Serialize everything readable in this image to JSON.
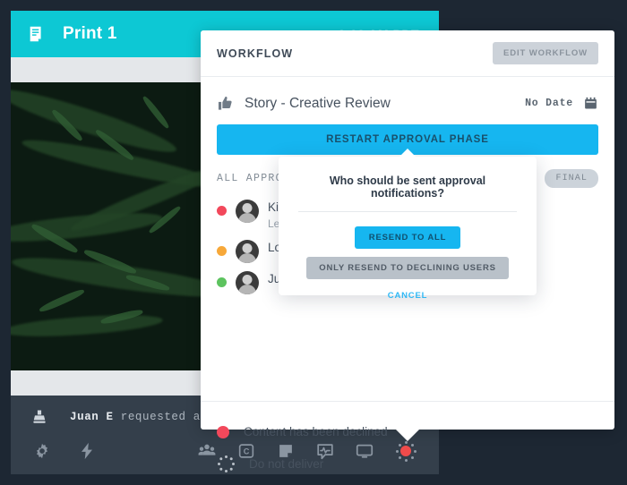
{
  "content_card": {
    "icon": "story-card-icon",
    "title": "Print 1",
    "time": "9:00 AM PDT",
    "activity": {
      "icon": "approval-stamp-icon",
      "actor": "Juan E",
      "text": "requested approv"
    },
    "toolbar": {
      "left": [
        {
          "name": "settings-gear-icon",
          "label": "Settings"
        },
        {
          "name": "automation-bolt-icon",
          "label": "Automation"
        }
      ],
      "right": [
        {
          "name": "audience-people-icon",
          "label": "Audience"
        },
        {
          "name": "campaign-c-icon",
          "label": "Campaign"
        },
        {
          "name": "note-icon",
          "label": "Notes"
        },
        {
          "name": "analytics-pulse-icon",
          "label": "Analytics"
        },
        {
          "name": "preview-monitor-icon",
          "label": "Preview"
        },
        {
          "name": "workflow-status-icon",
          "label": "Workflow",
          "active": true
        }
      ]
    }
  },
  "panel": {
    "header": {
      "title": "WORKFLOW",
      "edit_button": "EDIT WORKFLOW"
    },
    "story": {
      "icon": "thumbs-up-icon",
      "name": "Story - Creative Review",
      "date_label": "No Date",
      "calendar_icon": "calendar-icon"
    },
    "restart_button": "RESTART APPROVAL PHASE",
    "approvers_section": {
      "label": "ALL APPROVERS",
      "badge": "FINAL"
    },
    "approvers": [
      {
        "status_color": "#f2485b",
        "name": "Kimberly R",
        "sub": "Lead Designer"
      },
      {
        "status_color": "#f7a839",
        "name": "Lorena M",
        "sub": ""
      },
      {
        "status_color": "#5dc35f",
        "name": "Juan E",
        "sub": ""
      }
    ],
    "legend": [
      {
        "icon": "declined-dot-icon",
        "text": "Content has been declined"
      },
      {
        "icon": "do-not-deliver-icon",
        "text": "Do not deliver"
      }
    ]
  },
  "modal": {
    "title": "Who should be sent approval notifications?",
    "primary_button": "RESEND TO ALL",
    "secondary_button": "ONLY RESEND TO DECLINING USERS",
    "cancel_button": "CANCEL"
  },
  "colors": {
    "teal": "#0dc8d4",
    "blue": "#16b6f0",
    "dark": "#1d2733",
    "toolbar": "#343f4b",
    "red": "#f2485b",
    "amber": "#f7a839",
    "green": "#5dc35f"
  }
}
